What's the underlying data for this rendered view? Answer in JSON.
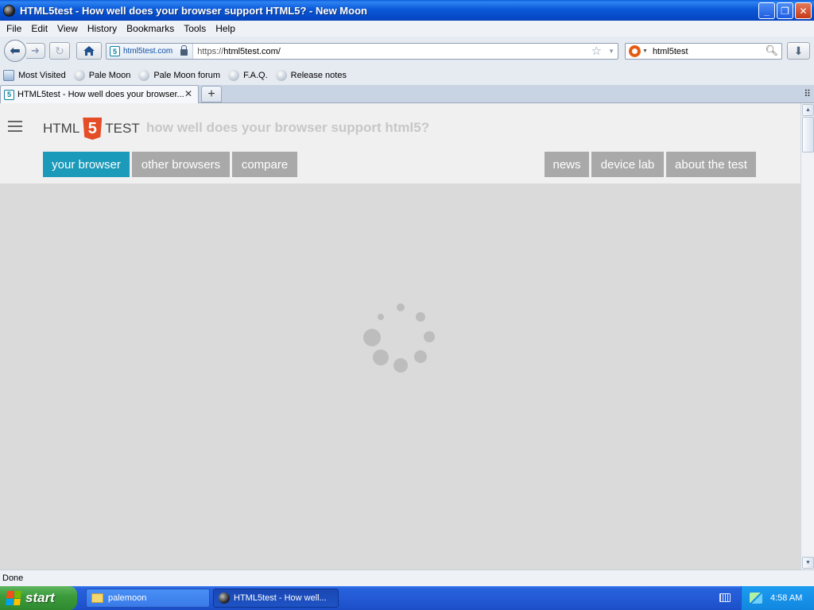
{
  "window": {
    "title": "HTML5test - How well does your browser support HTML5? - New Moon",
    "minimize": "_",
    "maximize": "❐",
    "close": "✕"
  },
  "menu": [
    "File",
    "Edit",
    "View",
    "History",
    "Bookmarks",
    "Tools",
    "Help"
  ],
  "nav": {
    "identity_label": "html5test.com",
    "url_protocol": "https://",
    "url_rest": "html5test.com/",
    "search_value": "html5test"
  },
  "bookmarks": [
    "Most Visited",
    "Pale Moon",
    "Pale Moon forum",
    "F.A.Q.",
    "Release notes"
  ],
  "tabs": [
    {
      "label": "HTML5test - How well does your browser..."
    }
  ],
  "site": {
    "logo_left": "HTML",
    "logo_mid": "5",
    "logo_right": "TEST",
    "tagline": "how well does your browser support html5?",
    "nav_left": [
      "your browser",
      "other browsers",
      "compare"
    ],
    "nav_right": [
      "news",
      "device lab",
      "about the test"
    ],
    "active_tab": "your browser",
    "accent_color": "#1b9aba",
    "inactive_color": "#a9a9a9"
  },
  "status": "Done",
  "taskbar": {
    "start": "start",
    "tasks": [
      "palemoon",
      "HTML5test - How well..."
    ],
    "clock": "4:58 AM"
  },
  "icons": {
    "back": "back-arrow-icon",
    "forward": "forward-arrow-icon",
    "reload": "reload-icon",
    "home": "home-icon",
    "bookmark_star": "star-icon",
    "search": "magnifier-icon",
    "download": "download-arrow-icon",
    "loading": "spinner-icon"
  }
}
